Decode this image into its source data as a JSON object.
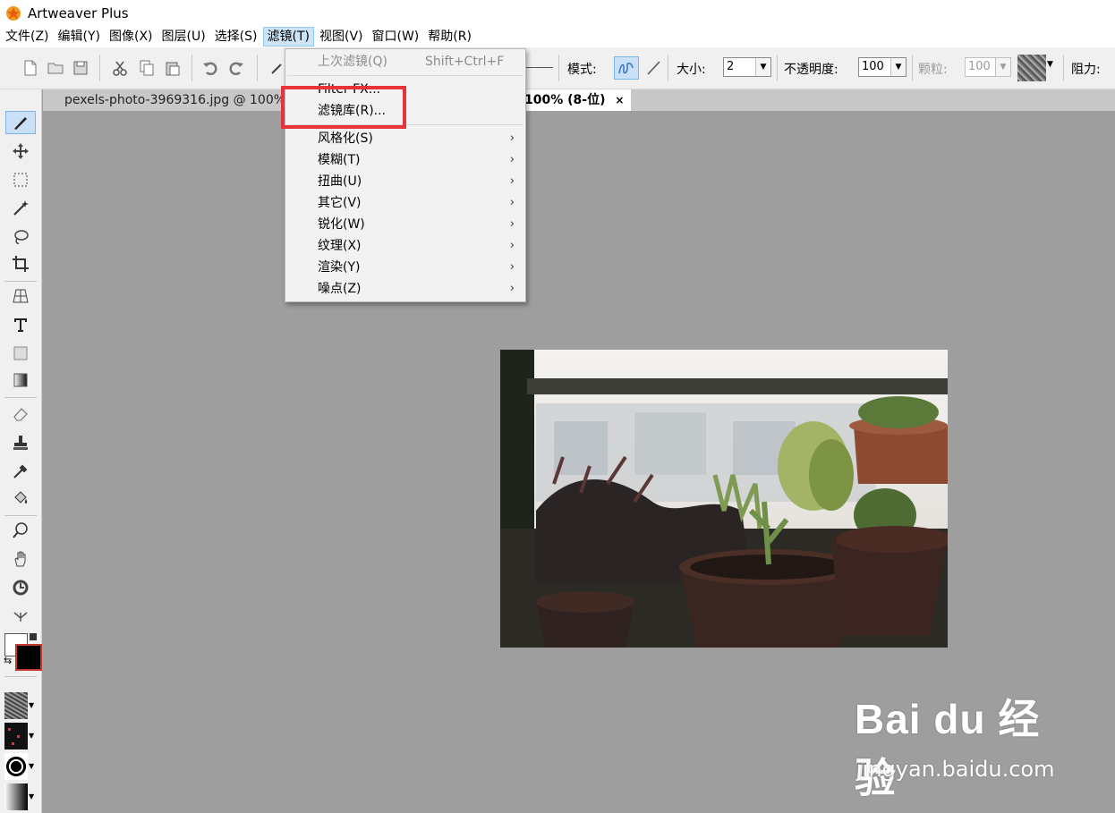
{
  "window": {
    "title": "Artweaver Plus"
  },
  "menubar": [
    {
      "label": "文件(Z)"
    },
    {
      "label": "编辑(Y)"
    },
    {
      "label": "图像(X)"
    },
    {
      "label": "图层(U)"
    },
    {
      "label": "选择(S)"
    },
    {
      "label": "滤镜(T)",
      "active": true
    },
    {
      "label": "视图(V)"
    },
    {
      "label": "窗口(W)"
    },
    {
      "label": "帮助(R)"
    }
  ],
  "toolbar": {
    "mode_label": "模式:",
    "size_label": "大小:",
    "size_value": "2",
    "opacity_label": "不透明度:",
    "opacity_value": "100",
    "grain_label": "颗粒:",
    "grain_value": "100",
    "resistance_label": "阻力:"
  },
  "tabs": {
    "inactive": "pexels-photo-3969316.jpg @ 100% (",
    "active": "100% (8-位)",
    "close": "×"
  },
  "filter_menu": {
    "last_filter": {
      "label": "上次滤镜(Q)",
      "shortcut": "Shift+Ctrl+F"
    },
    "filter_fx": "Filter FX...",
    "gallery": "滤镜库(R)...",
    "submenus": [
      "风格化(S)",
      "模糊(T)",
      "扭曲(U)",
      "其它(V)",
      "锐化(W)",
      "纹理(X)",
      "渲染(Y)",
      "噪点(Z)"
    ]
  },
  "watermark": {
    "logo": "Bai du 经验",
    "url": "jingyan.baidu.com"
  },
  "colors": {
    "accent": "#e8333a",
    "menu_highlight": "#cce4f7",
    "canvas_bg": "#9e9e9e"
  }
}
